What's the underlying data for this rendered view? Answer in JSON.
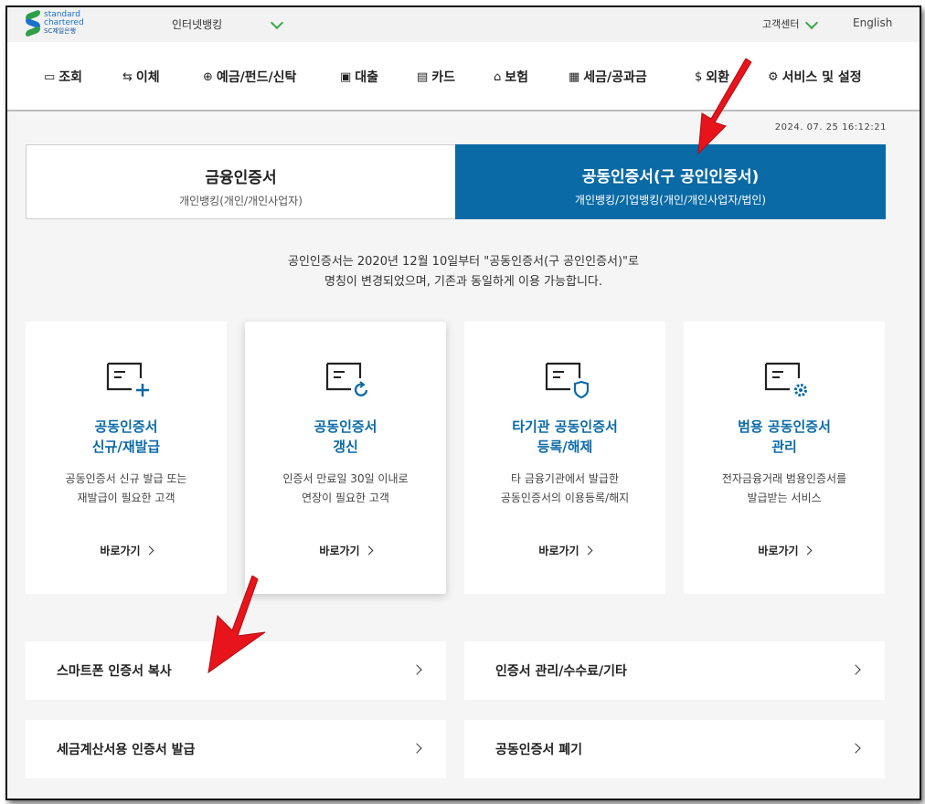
{
  "header": {
    "logo_line1": "standard",
    "logo_line2": "chartered",
    "logo_line3": "SC제일은행",
    "bank_select": "인터넷뱅킹",
    "customer_center": "고객센터",
    "language": "English",
    "brand_green": "#3aa94b",
    "brand_blue": "#0a6aa6"
  },
  "nav": [
    {
      "label": "조회",
      "icon": "monitor-icon"
    },
    {
      "label": "이체",
      "icon": "transfer-arrows-icon"
    },
    {
      "label": "예금/펀드/신탁",
      "icon": "deposit-icon"
    },
    {
      "label": "대출",
      "icon": "loan-icon"
    },
    {
      "label": "카드",
      "icon": "card-icon"
    },
    {
      "label": "보험",
      "icon": "house-icon"
    },
    {
      "label": "세금/공과금",
      "icon": "tax-icon"
    },
    {
      "label": "외환",
      "icon": "dollar-icon"
    },
    {
      "label": "서비스 및 설정",
      "icon": "gear-icon"
    }
  ],
  "timestamp": "2024. 07. 25 16:12:21",
  "tabs": [
    {
      "title": "금융인증서",
      "subtitle": "개인뱅킹(개인/개인사업자)",
      "active": false
    },
    {
      "title": "공동인증서(구 공인인증서)",
      "subtitle": "개인뱅킹/기업뱅킹(개인/개인사업자/법인)",
      "active": true
    }
  ],
  "notice": {
    "line1": "공인인증서는 2020년 12월 10일부터 \"공동인증서(구 공인인증서)\"로",
    "line2": "명칭이 변경되었으며, 기존과 동일하게 이용 가능합니다."
  },
  "cards": [
    {
      "title1": "공동인증서",
      "title2": "신규/재발급",
      "desc1": "공동인증서 신규 발급 또는",
      "desc2": "재발급이 필요한 고객",
      "link": "바로가기",
      "icon": "certificate-plus-icon"
    },
    {
      "title1": "공동인증서",
      "title2": "갱신",
      "desc1": "인증서 만료일 30일 이내로",
      "desc2": "연장이 필요한 고객",
      "link": "바로가기",
      "icon": "certificate-renew-icon"
    },
    {
      "title1": "타기관 공동인증서",
      "title2": "등록/해제",
      "desc1": "타 금융기관에서 발급한",
      "desc2": "공동인증서의 이용등록/해지",
      "link": "바로가기",
      "icon": "certificate-shield-icon"
    },
    {
      "title1": "범용 공동인증서",
      "title2": "관리",
      "desc1": "전자금융거래 범용인증서를",
      "desc2": "발급받는 서비스",
      "link": "바로가기",
      "icon": "certificate-gear-icon"
    }
  ],
  "rows": [
    {
      "label": "스마트폰 인증서 복사"
    },
    {
      "label": "인증서 관리/수수료/기타"
    },
    {
      "label": "세금계산서용 인증서 발급"
    },
    {
      "label": "공동인증서 폐기"
    }
  ],
  "annotation_color": "#e8141c"
}
